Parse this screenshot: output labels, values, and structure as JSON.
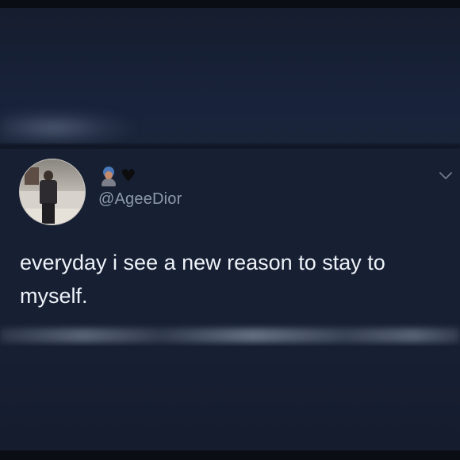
{
  "tweet": {
    "handle": "@AgeeDior",
    "display_name_emojis": [
      "person-emoji",
      "black-heart"
    ],
    "heart_glyph": "♥",
    "text": "everyday i see a new reason to stay to myself."
  },
  "colors": {
    "background": "#172033",
    "text": "#eef2f8",
    "handle": "#8d99ad"
  }
}
